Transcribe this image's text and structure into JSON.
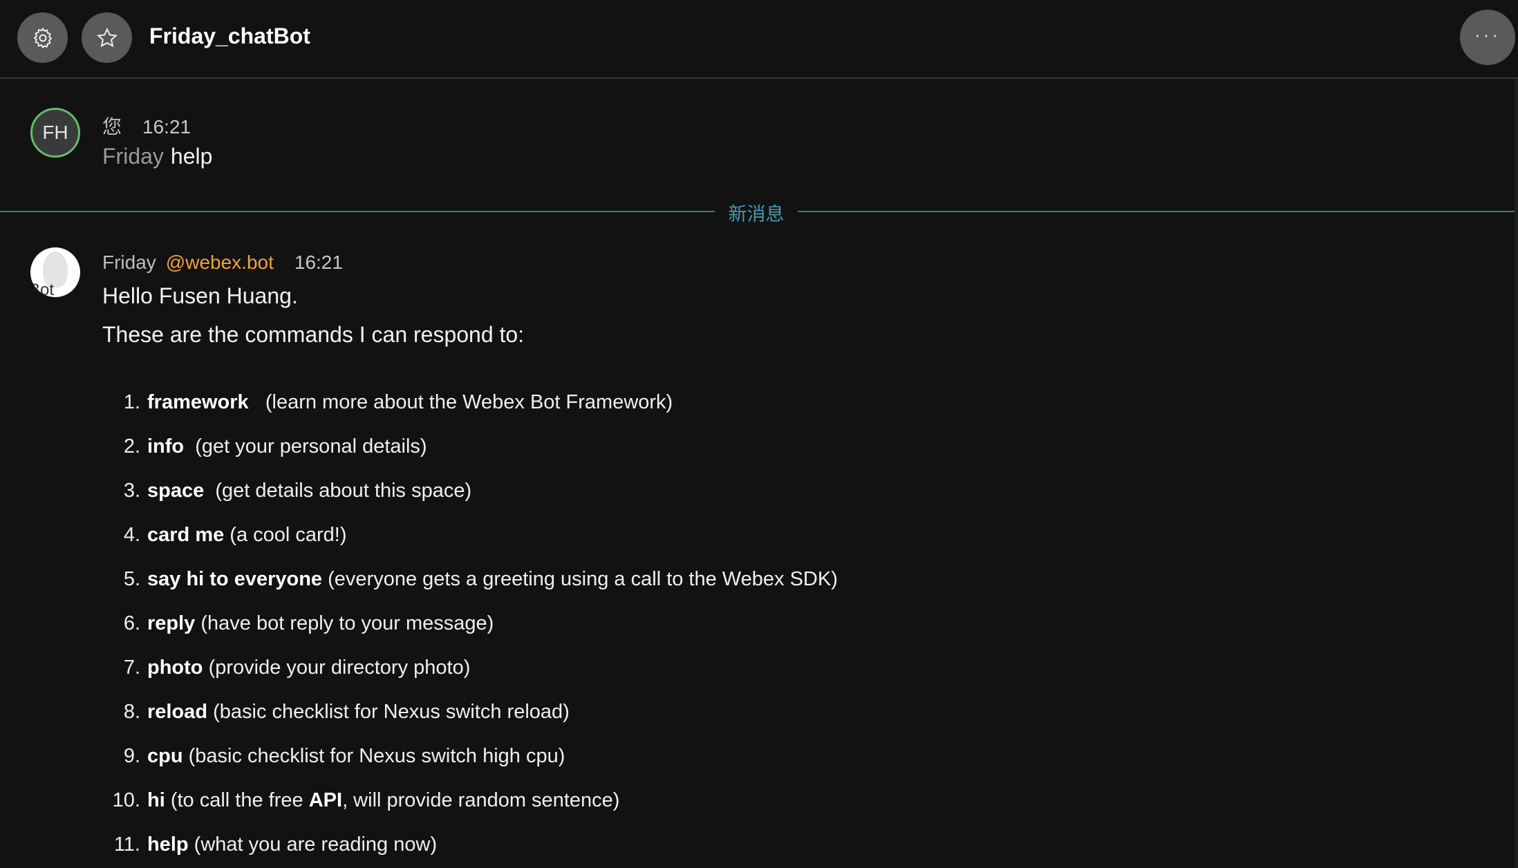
{
  "header": {
    "title": "Friday_chatBot",
    "settings_icon": "gear-icon",
    "favorite_icon": "star-icon",
    "more_label": "···"
  },
  "message1": {
    "avatar_initials": "FH",
    "sender": "您",
    "time": "16:21",
    "mention": "Friday",
    "text": "help"
  },
  "divider": {
    "label": "新消息"
  },
  "message2": {
    "avatar_label": "Bot",
    "sender": "Friday",
    "domain": "@webex.bot",
    "time": "16:21",
    "greeting": "Hello Fusen Huang.",
    "intro": "These are the commands I can respond to:",
    "commands": [
      {
        "num": "1.",
        "name": "framework",
        "desc": "   (learn more about the Webex Bot Framework)"
      },
      {
        "num": "2.",
        "name": "info",
        "desc": "  (get your personal details)"
      },
      {
        "num": "3.",
        "name": "space",
        "desc": "  (get details about this space)"
      },
      {
        "num": "4.",
        "name": "card me",
        "desc": " (a cool card!)"
      },
      {
        "num": "5.",
        "name": "say hi to everyone",
        "desc": " (everyone gets a greeting using a call to the Webex SDK)"
      },
      {
        "num": "6.",
        "name": "reply",
        "desc": " (have bot reply to your message)"
      },
      {
        "num": "7.",
        "name": "photo",
        "desc": " (provide your directory photo)"
      },
      {
        "num": "8.",
        "name": "reload",
        "desc": " (basic checklist for Nexus switch reload)"
      },
      {
        "num": "9.",
        "name": "cpu",
        "desc": " (basic checklist for Nexus switch high cpu)"
      },
      {
        "num": "10.",
        "name": "hi",
        "desc_before": " (to call the free ",
        "desc_bold": "API",
        "desc_after": ", will provide random sentence)"
      },
      {
        "num": "11.",
        "name": "help",
        "desc": " (what you are reading now)"
      }
    ]
  }
}
